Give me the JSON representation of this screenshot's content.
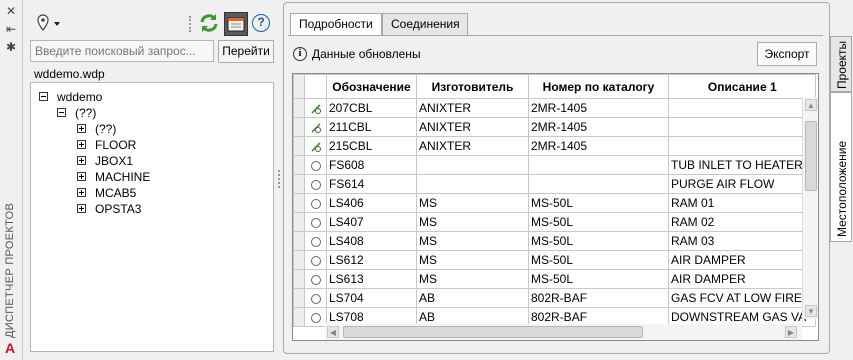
{
  "sidebar": {
    "close_glyph": "✕",
    "pin_glyph": "⇤",
    "settings_glyph": "✱",
    "vertical_title": "ДИСПЕТЧЕР ПРОЕКТОВ",
    "logo_letter": "A"
  },
  "project_pane": {
    "search_placeholder": "Введите поисковый запрос...",
    "go_button": "Перейти",
    "project_file": "wddemo.wdp",
    "tree": {
      "root": "wddemo",
      "group": "(??)",
      "children": [
        "(??)",
        "FLOOR",
        "JBOX1",
        "MACHINE",
        "MCAB5",
        "OPSTA3"
      ]
    }
  },
  "tabs": {
    "details": "Подробности",
    "connections": "Соединения"
  },
  "details": {
    "status": "Данные обновлены",
    "export_button": "Экспорт"
  },
  "grid": {
    "columns": [
      "Обозначение",
      "Изготовитель",
      "Номер по каталогу",
      "Описание 1"
    ],
    "rows": [
      {
        "icon": "edit-device-icon",
        "tag": "207CBL",
        "mfr": "ANIXTER",
        "cat": "2MR-1405",
        "desc": ""
      },
      {
        "icon": "edit-device-icon",
        "tag": "211CBL",
        "mfr": "ANIXTER",
        "cat": "2MR-1405",
        "desc": ""
      },
      {
        "icon": "edit-device-icon",
        "tag": "215CBL",
        "mfr": "ANIXTER",
        "cat": "2MR-1405",
        "desc": ""
      },
      {
        "icon": "component-dot-icon",
        "tag": "FS608",
        "mfr": "",
        "cat": "",
        "desc": "TUB INLET TO HEATER F"
      },
      {
        "icon": "component-dot-icon",
        "tag": "FS614",
        "mfr": "",
        "cat": "",
        "desc": "PURGE AIR FLOW"
      },
      {
        "icon": "component-dot-icon",
        "tag": "LS406",
        "mfr": "MS",
        "cat": "MS-50L",
        "desc": "RAM 01"
      },
      {
        "icon": "component-dot-icon",
        "tag": "LS407",
        "mfr": "MS",
        "cat": "MS-50L",
        "desc": "RAM 02"
      },
      {
        "icon": "component-dot-icon",
        "tag": "LS408",
        "mfr": "MS",
        "cat": "MS-50L",
        "desc": "RAM 03"
      },
      {
        "icon": "component-dot-icon",
        "tag": "LS612",
        "mfr": "MS",
        "cat": "MS-50L",
        "desc": "AIR DAMPER"
      },
      {
        "icon": "component-dot-icon",
        "tag": "LS613",
        "mfr": "MS",
        "cat": "MS-50L",
        "desc": "AIR DAMPER"
      },
      {
        "icon": "component-dot-icon",
        "tag": "LS704",
        "mfr": "AB",
        "cat": "802R-BAF",
        "desc": "GAS FCV AT LOW FIRE"
      },
      {
        "icon": "component-dot-icon",
        "tag": "LS708",
        "mfr": "AB",
        "cat": "802R-BAF",
        "desc": "DOWNSTREAM GAS VA"
      }
    ]
  },
  "right_tabs": {
    "projects": "Проекты",
    "location": "Местоположение"
  },
  "colors": {
    "refresh_green": "#3a9a2e",
    "help_blue": "#1d5aa8",
    "logo_red": "#c8102e"
  }
}
